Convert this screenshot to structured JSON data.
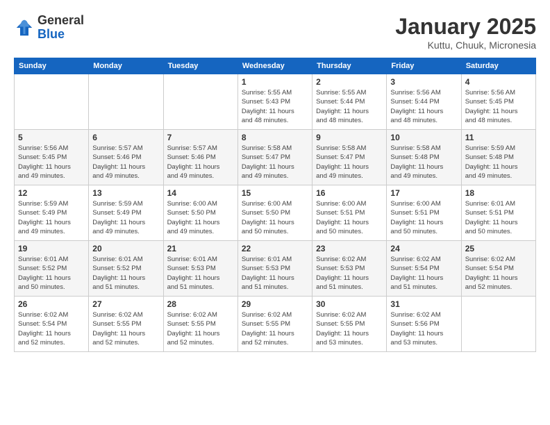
{
  "logo": {
    "general": "General",
    "blue": "Blue"
  },
  "title": "January 2025",
  "location": "Kuttu, Chuuk, Micronesia",
  "days_of_week": [
    "Sunday",
    "Monday",
    "Tuesday",
    "Wednesday",
    "Thursday",
    "Friday",
    "Saturday"
  ],
  "weeks": [
    [
      {
        "day": "",
        "info": ""
      },
      {
        "day": "",
        "info": ""
      },
      {
        "day": "",
        "info": ""
      },
      {
        "day": "1",
        "info": "Sunrise: 5:55 AM\nSunset: 5:43 PM\nDaylight: 11 hours\nand 48 minutes."
      },
      {
        "day": "2",
        "info": "Sunrise: 5:55 AM\nSunset: 5:44 PM\nDaylight: 11 hours\nand 48 minutes."
      },
      {
        "day": "3",
        "info": "Sunrise: 5:56 AM\nSunset: 5:44 PM\nDaylight: 11 hours\nand 48 minutes."
      },
      {
        "day": "4",
        "info": "Sunrise: 5:56 AM\nSunset: 5:45 PM\nDaylight: 11 hours\nand 48 minutes."
      }
    ],
    [
      {
        "day": "5",
        "info": "Sunrise: 5:56 AM\nSunset: 5:45 PM\nDaylight: 11 hours\nand 49 minutes."
      },
      {
        "day": "6",
        "info": "Sunrise: 5:57 AM\nSunset: 5:46 PM\nDaylight: 11 hours\nand 49 minutes."
      },
      {
        "day": "7",
        "info": "Sunrise: 5:57 AM\nSunset: 5:46 PM\nDaylight: 11 hours\nand 49 minutes."
      },
      {
        "day": "8",
        "info": "Sunrise: 5:58 AM\nSunset: 5:47 PM\nDaylight: 11 hours\nand 49 minutes."
      },
      {
        "day": "9",
        "info": "Sunrise: 5:58 AM\nSunset: 5:47 PM\nDaylight: 11 hours\nand 49 minutes."
      },
      {
        "day": "10",
        "info": "Sunrise: 5:58 AM\nSunset: 5:48 PM\nDaylight: 11 hours\nand 49 minutes."
      },
      {
        "day": "11",
        "info": "Sunrise: 5:59 AM\nSunset: 5:48 PM\nDaylight: 11 hours\nand 49 minutes."
      }
    ],
    [
      {
        "day": "12",
        "info": "Sunrise: 5:59 AM\nSunset: 5:49 PM\nDaylight: 11 hours\nand 49 minutes."
      },
      {
        "day": "13",
        "info": "Sunrise: 5:59 AM\nSunset: 5:49 PM\nDaylight: 11 hours\nand 49 minutes."
      },
      {
        "day": "14",
        "info": "Sunrise: 6:00 AM\nSunset: 5:50 PM\nDaylight: 11 hours\nand 49 minutes."
      },
      {
        "day": "15",
        "info": "Sunrise: 6:00 AM\nSunset: 5:50 PM\nDaylight: 11 hours\nand 50 minutes."
      },
      {
        "day": "16",
        "info": "Sunrise: 6:00 AM\nSunset: 5:51 PM\nDaylight: 11 hours\nand 50 minutes."
      },
      {
        "day": "17",
        "info": "Sunrise: 6:00 AM\nSunset: 5:51 PM\nDaylight: 11 hours\nand 50 minutes."
      },
      {
        "day": "18",
        "info": "Sunrise: 6:01 AM\nSunset: 5:51 PM\nDaylight: 11 hours\nand 50 minutes."
      }
    ],
    [
      {
        "day": "19",
        "info": "Sunrise: 6:01 AM\nSunset: 5:52 PM\nDaylight: 11 hours\nand 50 minutes."
      },
      {
        "day": "20",
        "info": "Sunrise: 6:01 AM\nSunset: 5:52 PM\nDaylight: 11 hours\nand 51 minutes."
      },
      {
        "day": "21",
        "info": "Sunrise: 6:01 AM\nSunset: 5:53 PM\nDaylight: 11 hours\nand 51 minutes."
      },
      {
        "day": "22",
        "info": "Sunrise: 6:01 AM\nSunset: 5:53 PM\nDaylight: 11 hours\nand 51 minutes."
      },
      {
        "day": "23",
        "info": "Sunrise: 6:02 AM\nSunset: 5:53 PM\nDaylight: 11 hours\nand 51 minutes."
      },
      {
        "day": "24",
        "info": "Sunrise: 6:02 AM\nSunset: 5:54 PM\nDaylight: 11 hours\nand 51 minutes."
      },
      {
        "day": "25",
        "info": "Sunrise: 6:02 AM\nSunset: 5:54 PM\nDaylight: 11 hours\nand 52 minutes."
      }
    ],
    [
      {
        "day": "26",
        "info": "Sunrise: 6:02 AM\nSunset: 5:54 PM\nDaylight: 11 hours\nand 52 minutes."
      },
      {
        "day": "27",
        "info": "Sunrise: 6:02 AM\nSunset: 5:55 PM\nDaylight: 11 hours\nand 52 minutes."
      },
      {
        "day": "28",
        "info": "Sunrise: 6:02 AM\nSunset: 5:55 PM\nDaylight: 11 hours\nand 52 minutes."
      },
      {
        "day": "29",
        "info": "Sunrise: 6:02 AM\nSunset: 5:55 PM\nDaylight: 11 hours\nand 52 minutes."
      },
      {
        "day": "30",
        "info": "Sunrise: 6:02 AM\nSunset: 5:55 PM\nDaylight: 11 hours\nand 53 minutes."
      },
      {
        "day": "31",
        "info": "Sunrise: 6:02 AM\nSunset: 5:56 PM\nDaylight: 11 hours\nand 53 minutes."
      },
      {
        "day": "",
        "info": ""
      }
    ]
  ]
}
